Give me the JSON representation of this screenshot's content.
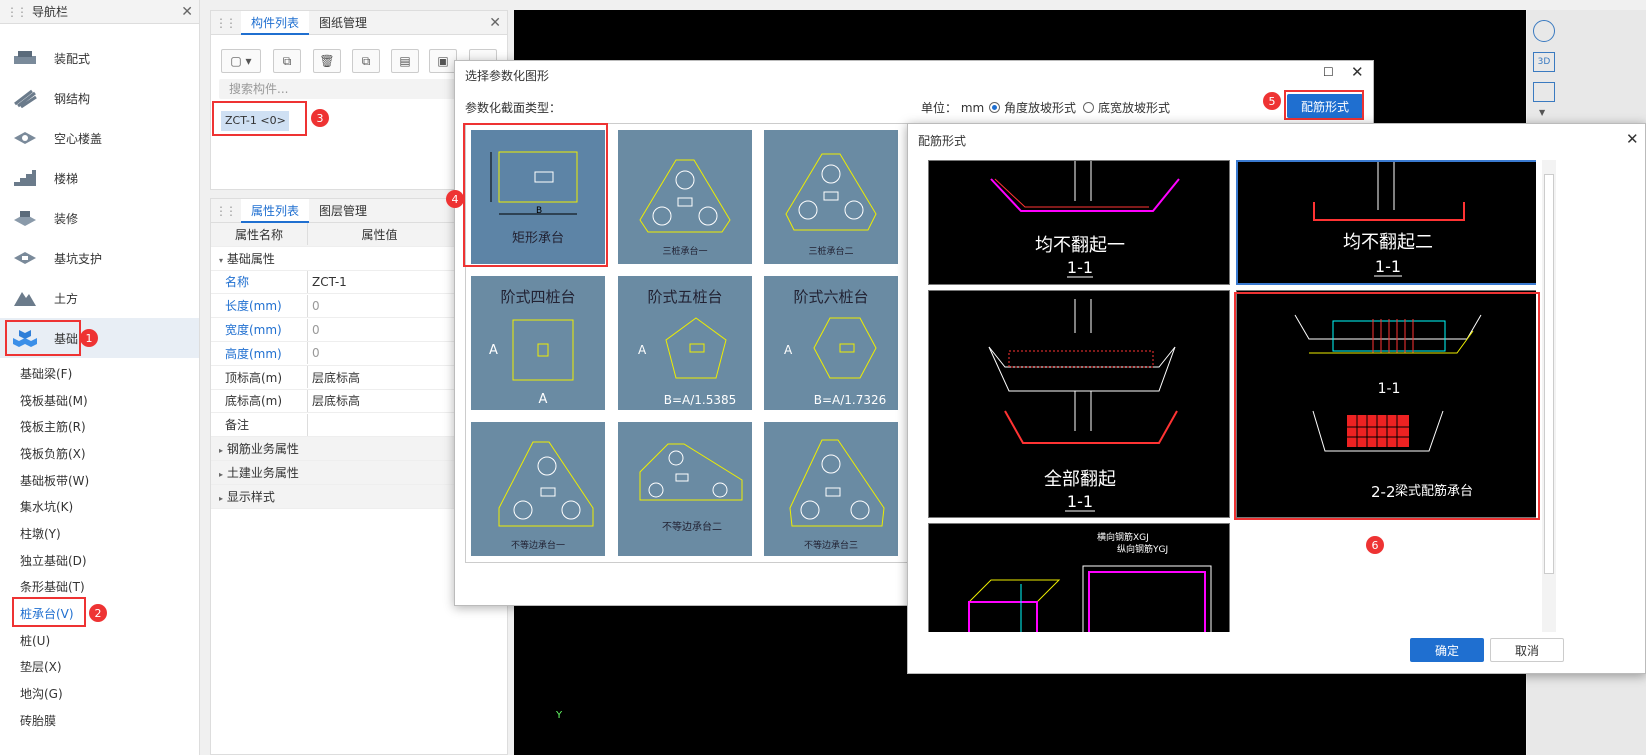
{
  "nav": {
    "title": "导航栏",
    "categories": [
      "装配式",
      "钢结构",
      "空心楼盖",
      "楼梯",
      "装修",
      "基坑支护",
      "土方",
      "基础"
    ],
    "items": [
      "基础梁(F)",
      "筏板基础(M)",
      "筏板主筋(R)",
      "筏板负筋(X)",
      "基础板带(W)",
      "集水坑(K)",
      "柱墩(Y)",
      "独立基础(D)",
      "条形基础(T)",
      "桩承台(V)",
      "桩(U)",
      "垫层(X)",
      "地沟(G)",
      "砖胎膜"
    ]
  },
  "comp": {
    "tabs": [
      "构件列表",
      "图纸管理"
    ],
    "search_placeholder": "搜索构件...",
    "item": "ZCT-1 <0>"
  },
  "attr": {
    "tabs": [
      "属性列表",
      "图层管理"
    ],
    "col_name": "属性名称",
    "col_value": "属性值",
    "group": "基础属性",
    "rows": [
      {
        "k": "名称",
        "v": "ZCT-1"
      },
      {
        "k": "长度(mm)",
        "v": "0"
      },
      {
        "k": "宽度(mm)",
        "v": "0"
      },
      {
        "k": "高度(mm)",
        "v": "0"
      },
      {
        "k": "顶标高(m)",
        "v": "层底标高"
      },
      {
        "k": "底标高(m)",
        "v": "层底标高"
      },
      {
        "k": "备注",
        "v": ""
      }
    ],
    "groups": [
      "钢筋业务属性",
      "土建业务属性",
      "显示样式"
    ]
  },
  "dialog1": {
    "title": "选择参数化图形",
    "type_label": "参数化截面类型：",
    "unit_label": "单位：",
    "unit": "mm",
    "radio1": "角度放坡形式",
    "radio2": "底宽放坡形式",
    "rebar_button": "配筋形式",
    "tiles": [
      {
        "name": "矩形承台",
        "sub": "B"
      },
      {
        "name": "三桩承台一",
        "sub": ""
      },
      {
        "name": "三桩承台二",
        "sub": ""
      },
      {
        "name": "阶式四桩台",
        "sub": "A"
      },
      {
        "name": "阶式五桩台",
        "sub": "B=A/1.5385"
      },
      {
        "name": "阶式六桩台",
        "sub": "B=A/1.7326"
      },
      {
        "name": "不等边承台一",
        "sub": ""
      },
      {
        "name": "不等边承台二",
        "sub": ""
      },
      {
        "name": "不等边承台三",
        "sub": ""
      }
    ]
  },
  "dialog2": {
    "title": "配筋形式",
    "tiles": [
      {
        "name": "均不翻起一",
        "sec": "1-1"
      },
      {
        "name": "均不翻起二",
        "sec": "1-1"
      },
      {
        "name": "全部翻起",
        "sec": "1-1"
      },
      {
        "name": "梁式配筋承台",
        "sec1": "1-1",
        "sec2": "2-2"
      },
      {
        "name": "",
        "labels": [
          "横向钢筋XGJ",
          "纵向钢筋YGJ"
        ]
      }
    ],
    "ok": "确定",
    "cancel": "取消"
  },
  "badges": [
    "1",
    "2",
    "3",
    "4",
    "5",
    "6"
  ],
  "accent": "#1f6fd0",
  "highlight": "#e33333"
}
